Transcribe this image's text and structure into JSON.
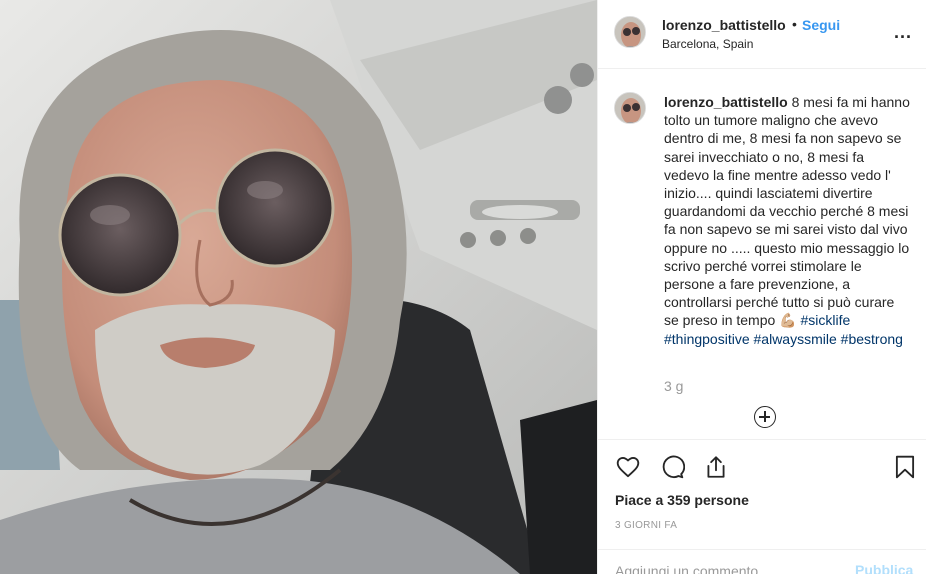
{
  "photo": {
    "alt_subject": "selfie-on-airplane"
  },
  "header": {
    "username": "lorenzo_battistello",
    "dot": "•",
    "follow_label": "Segui",
    "location": "Barcelona, Spain",
    "more_icon": "more-horizontal-icon",
    "more_label": "..."
  },
  "caption": {
    "username": "lorenzo_battistello",
    "text": "8 mesi fa mi hanno tolto un tumore maligno che avevo dentro di me, 8 mesi fa non sapevo se sarei invecchiato o no, 8 mesi fa vedevo la fine mentre adesso vedo l' inizio.... quindi lasciatemi divertire guardandomi da vecchio perché 8 mesi fa non sapevo se mi sarei visto dal vivo oppure no ..... questo mio messaggio lo scrivo perché vorrei stimolare le persone a fare prevenzione, a controllarsi perché tutto si può curare se preso in tempo",
    "emoji": "💪🏼",
    "hashtags": [
      "#sicklife",
      "#thingpositive",
      "#alwayssmile",
      "#bestrong"
    ],
    "age": "3 g",
    "load_more_icon": "plus-circle-icon"
  },
  "actions": {
    "like_icon": "heart-icon",
    "comment_icon": "comment-icon",
    "share_icon": "share-icon",
    "save_icon": "bookmark-icon",
    "likes_text": "Piace a 359 persone",
    "date": "3 GIORNI FA"
  },
  "comment": {
    "placeholder": "Aggiungi un commento...",
    "publish_label": "Pubblica",
    "publish_color": "#b2dffc"
  },
  "colors": {
    "link": "#3897f0",
    "hashtag": "#003569",
    "muted": "#999999",
    "text": "#262626"
  }
}
